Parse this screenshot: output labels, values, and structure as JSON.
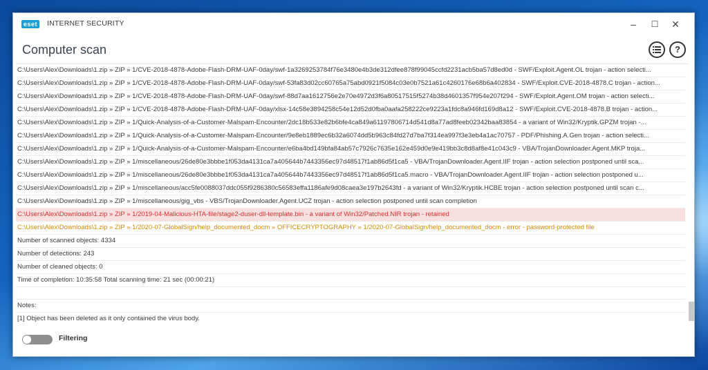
{
  "window": {
    "logo_text": "eset",
    "app_title": "INTERNET SECURITY",
    "page_title": "Computer scan",
    "controls": {
      "minimize": "–",
      "maximize": "☐",
      "close": "✕"
    },
    "menu_icon": "list-menu-icon",
    "help_icon": "?"
  },
  "log": {
    "rows": [
      {
        "text": "C:\\Users\\Alex\\Downloads\\1.zip » ZIP » 1/CVE-2018-4878-Adobe-Flash-DRM-UAF-0day/swf-1a3269253784f76e3480e4b3de312dfee878f99045ccfd2231acb5ba57d8ed0d - SWF/Exploit.Agent.OL trojan - action selecti...",
        "style": "normal"
      },
      {
        "text": "C:\\Users\\Alex\\Downloads\\1.zip » ZIP » 1/CVE-2018-4878-Adobe-Flash-DRM-UAF-0day/swf-53fa83d02cc60765a75abd0921f5084c03e0b7521a61c4260176e68b6a402834 - SWF/Exploit.CVE-2018-4878.C trojan - action...",
        "style": "normal"
      },
      {
        "text": "C:\\Users\\Alex\\Downloads\\1.zip » ZIP » 1/CVE-2018-4878-Adobe-Flash-DRM-UAF-0day/swf-88d7aa1612756e2e70e4972d3f6a80517515f5274b38d4601357f954e207f294 - SWF/Exploit.Agent.OM trojan - action selecti...",
        "style": "normal"
      },
      {
        "text": "C:\\Users\\Alex\\Downloads\\1.zip » ZIP » 1/CVE-2018-4878-Adobe-Flash-DRM-UAF-0day/xlsx-14c58e3894258c54e12d52d0fba0aafa258222ce9223a1fdc8a946fd169d8a12 - SWF/Exploit.CVE-2018-4878.B trojan - action...",
        "style": "normal"
      },
      {
        "text": "C:\\Users\\Alex\\Downloads\\1.zip » ZIP » 1/Quick-Analysis-of-a-Customer-Malspam-Encounter/2dc18b533e82b6bfe4ca849a61197806714d541d8a77ad8feeb02342baa83854 - a variant of Win32/Kryptik.GPZM trojan -...",
        "style": "normal"
      },
      {
        "text": "C:\\Users\\Alex\\Downloads\\1.zip » ZIP » 1/Quick-Analysis-of-a-Customer-Malspam-Encounter/9e8eb1889ec6b32a6074dd5b963c84fd27d7ba7f314ea997f3e3eb4a1ac70757 - PDF/Phishing.A.Gen trojan - action selecti...",
        "style": "normal"
      },
      {
        "text": "C:\\Users\\Alex\\Downloads\\1.zip » ZIP » 1/Quick-Analysis-of-a-Customer-Malspam-Encounter/e6ba4bd149bfa84ab57c7926c7635e162e459d0e9e419bb3c8d8af8e41c043c9 - VBA/TrojanDownloader.Agent.MKP troja...",
        "style": "normal"
      },
      {
        "text": "C:\\Users\\Alex\\Downloads\\1.zip » ZIP » 1/miscellaneous/26de80e3bbbe1f053da4131ca7a405644b7443356ec97d48517f1ab86d5f1ca5 - VBA/TrojanDownloader.Agent.IIF trojan - action selection postponed until sca...",
        "style": "normal"
      },
      {
        "text": "C:\\Users\\Alex\\Downloads\\1.zip » ZIP » 1/miscellaneous/26de80e3bbbe1f053da4131ca7a405644b7443356ec97d48517f1ab86d5f1ca5.macro - VBA/TrojanDownloader.Agent.IIF trojan - action selection postponed u...",
        "style": "normal"
      },
      {
        "text": "C:\\Users\\Alex\\Downloads\\1.zip » ZIP » 1/miscellaneous/acc5fe0088037ddc055f9286380c56583effa1186afe9d08caea3e197b2643fd - a variant of Win32/Kryptik.HCBE trojan - action selection postponed until scan c...",
        "style": "normal"
      },
      {
        "text": "C:\\Users\\Alex\\Downloads\\1.zip » ZIP » 1/miscellaneous/gig_vbs - VBS/TrojanDownloader.Agent.UCZ trojan - action selection postponed until scan completion",
        "style": "normal"
      },
      {
        "text": "C:\\Users\\Alex\\Downloads\\1.zip » ZIP » 1/2019-04-Malicious-HTA-file/stage2-duser-dll-template.bin - a variant of Win32/Patched.NIR trojan - retained",
        "style": "red"
      },
      {
        "text": "C:\\Users\\Alex\\Downloads\\1.zip » ZIP » 1/2020-07-GlobalSign/help_documented_docm » OFFICECRYPTOGRAPHY » 1/2020-07-GlobalSign/help_documented_docm - error - password-protected file",
        "style": "orange"
      },
      {
        "text": "Number of scanned objects: 4334",
        "style": "normal"
      },
      {
        "text": "Number of detections: 243",
        "style": "normal"
      },
      {
        "text": "Number of cleaned objects: 0",
        "style": "normal"
      },
      {
        "text": "Time of completion: 10:35:58  Total scanning time: 21 sec (00:00:21)",
        "style": "normal"
      },
      {
        "text": "",
        "style": "blank"
      },
      {
        "text": "Notes:",
        "style": "normal"
      },
      {
        "text": "[1] Object has been deleted as it only contained the virus body.",
        "style": "normal"
      }
    ]
  },
  "filter": {
    "label": "Filtering",
    "enabled": false
  },
  "colors": {
    "accent": "#1a9fd9",
    "detection_red": "#d93030",
    "warning_orange": "#d78b00"
  }
}
